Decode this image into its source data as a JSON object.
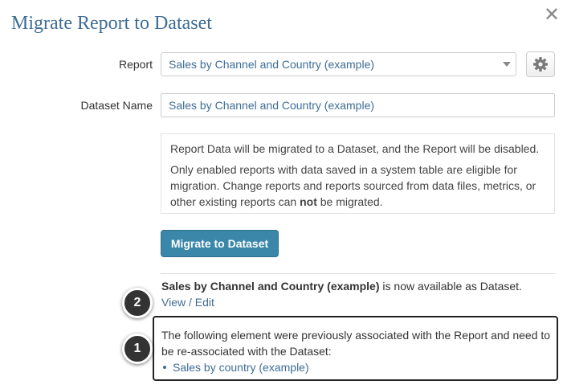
{
  "dialog": {
    "title": "Migrate Report to Dataset",
    "close_label": "✕"
  },
  "form": {
    "report_label": "Report",
    "report_selected": "Sales by Channel and Country (example)",
    "dataset_label": "Dataset Name",
    "dataset_value": "Sales by Channel and Country (example)"
  },
  "info": {
    "line1": "Report Data will be migrated to a Dataset, and the Report will be disabled.",
    "line2_before": "Only enabled reports with data saved in a system table are eligible for migration. Change reports and reports sourced from data files, metrics, or other existing reports can ",
    "line2_bold": "not",
    "line2_after": " be migrated."
  },
  "actions": {
    "migrate_label": "Migrate to Dataset"
  },
  "result": {
    "report_name": "Sales by Channel and Country (example)",
    "message": " is now available as Dataset.",
    "view_label": "View",
    "separator": " / ",
    "edit_label": "Edit"
  },
  "associated": {
    "message": "The following element were previously associated with the Report and need to be re-associated with the Dataset:",
    "items": [
      {
        "label": "Sales by country (example)"
      }
    ]
  },
  "badges": {
    "one": "1",
    "two": "2"
  },
  "colors": {
    "title": "#3e6d96",
    "link": "#3e6d96",
    "primary_button": "#3a87a9",
    "badge": "#333333"
  },
  "icons": {
    "gear": "gear-icon",
    "close": "close-icon",
    "dropdown": "chevron-down-icon"
  }
}
